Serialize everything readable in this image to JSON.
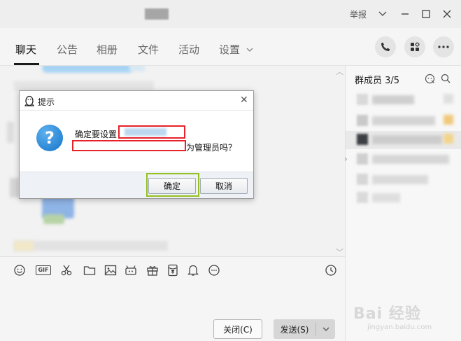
{
  "titlebar": {
    "report_label": "举报",
    "icons": [
      "chevron-down-icon",
      "minimize-icon",
      "maximize-icon",
      "close-icon"
    ]
  },
  "tabs": [
    {
      "label": "聊天",
      "active": true
    },
    {
      "label": "公告",
      "active": false
    },
    {
      "label": "相册",
      "active": false
    },
    {
      "label": "文件",
      "active": false
    },
    {
      "label": "活动",
      "active": false
    },
    {
      "label": "设置",
      "active": false
    }
  ],
  "toolbar": {
    "gif_label": "GIF"
  },
  "input": {
    "close_label": "关闭(C)",
    "send_label": "发送(S)"
  },
  "sidepanel": {
    "title": "群成员 3/5"
  },
  "dialog": {
    "title": "提示",
    "message_line1": "确定要设置",
    "message_line2_suffix": "为管理员吗？",
    "confirm_label": "确定",
    "cancel_label": "取消"
  },
  "watermark": {
    "text": "Bai 经验",
    "url": "jingyan.baidu.com"
  },
  "colors": {
    "highlight_red": "#e8222a",
    "highlight_green": "#94c11f",
    "question_blue": "#1574c9"
  }
}
